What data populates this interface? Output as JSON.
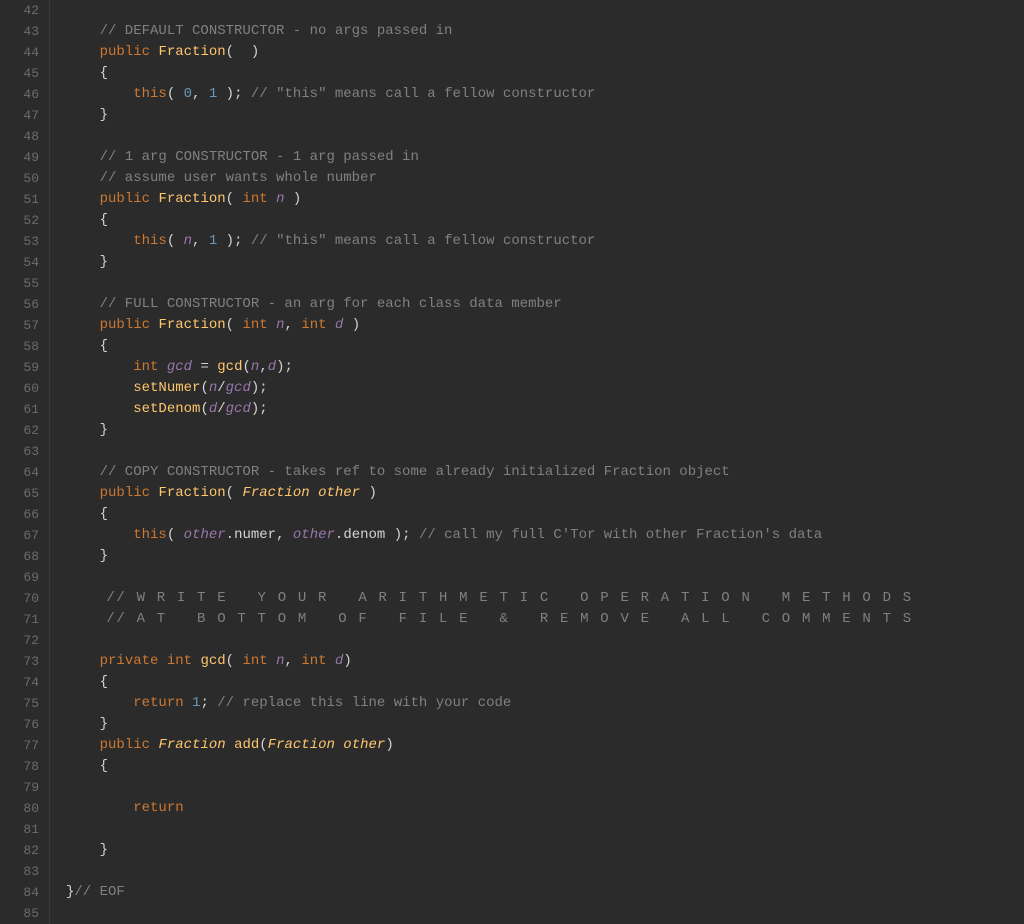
{
  "editor": {
    "background": "#2b2b2b",
    "lines": [
      {
        "num": 42,
        "content": ""
      },
      {
        "num": 43,
        "content": "    // DEFAULT CONSTRUCTOR - no args passed in"
      },
      {
        "num": 44,
        "content": "    public Fraction(  )"
      },
      {
        "num": 45,
        "content": "    {"
      },
      {
        "num": 46,
        "content": "        this( 0, 1 ); // \"this\" means call a fellow constructor"
      },
      {
        "num": 47,
        "content": "    }"
      },
      {
        "num": 48,
        "content": ""
      },
      {
        "num": 49,
        "content": "    // 1 arg CONSTRUCTOR - 1 arg passed in"
      },
      {
        "num": 50,
        "content": "    // assume user wants whole number"
      },
      {
        "num": 51,
        "content": "    public Fraction( int n )"
      },
      {
        "num": 52,
        "content": "    {"
      },
      {
        "num": 53,
        "content": "        this( n, 1 ); // \"this\" means call a fellow constructor"
      },
      {
        "num": 54,
        "content": "    }"
      },
      {
        "num": 55,
        "content": ""
      },
      {
        "num": 56,
        "content": "    // FULL CONSTRUCTOR - an arg for each class data member"
      },
      {
        "num": 57,
        "content": "    public Fraction( int n, int d )"
      },
      {
        "num": 58,
        "content": "    {"
      },
      {
        "num": 59,
        "content": "        int gcd = gcd(n,d);"
      },
      {
        "num": 60,
        "content": "        setNumer(n/gcd);"
      },
      {
        "num": 61,
        "content": "        setDenom(d/gcd);"
      },
      {
        "num": 62,
        "content": "    }"
      },
      {
        "num": 63,
        "content": ""
      },
      {
        "num": 64,
        "content": "    // COPY CONSTRUCTOR - takes ref to some already initialized Fraction object"
      },
      {
        "num": 65,
        "content": "    public Fraction( Fraction other )"
      },
      {
        "num": 66,
        "content": "    {"
      },
      {
        "num": 67,
        "content": "        this( other.numer, other.denom ); // call my full C'Tor with other Fraction's data"
      },
      {
        "num": 68,
        "content": "    }"
      },
      {
        "num": 69,
        "content": ""
      },
      {
        "num": 70,
        "content": "    // W R I T E   Y O U R   A R I T H M E T I C   O P E R A T I O N   M E T H O D S"
      },
      {
        "num": 71,
        "content": "    // A T   B O T T O M   O F   F I L E   &   R E M O V E   A L L   C O M M E N T S"
      },
      {
        "num": 72,
        "content": ""
      },
      {
        "num": 73,
        "content": "    private int gcd( int n, int d)"
      },
      {
        "num": 74,
        "content": "    {"
      },
      {
        "num": 75,
        "content": "        return 1; // replace this line with your code"
      },
      {
        "num": 76,
        "content": "    }"
      },
      {
        "num": 77,
        "content": "    public Fraction add(Fraction other)"
      },
      {
        "num": 78,
        "content": "    {"
      },
      {
        "num": 79,
        "content": ""
      },
      {
        "num": 80,
        "content": "        return"
      },
      {
        "num": 81,
        "content": ""
      },
      {
        "num": 82,
        "content": "    }"
      },
      {
        "num": 83,
        "content": ""
      },
      {
        "num": 84,
        "content": "}// EOF"
      },
      {
        "num": 85,
        "content": ""
      }
    ]
  }
}
